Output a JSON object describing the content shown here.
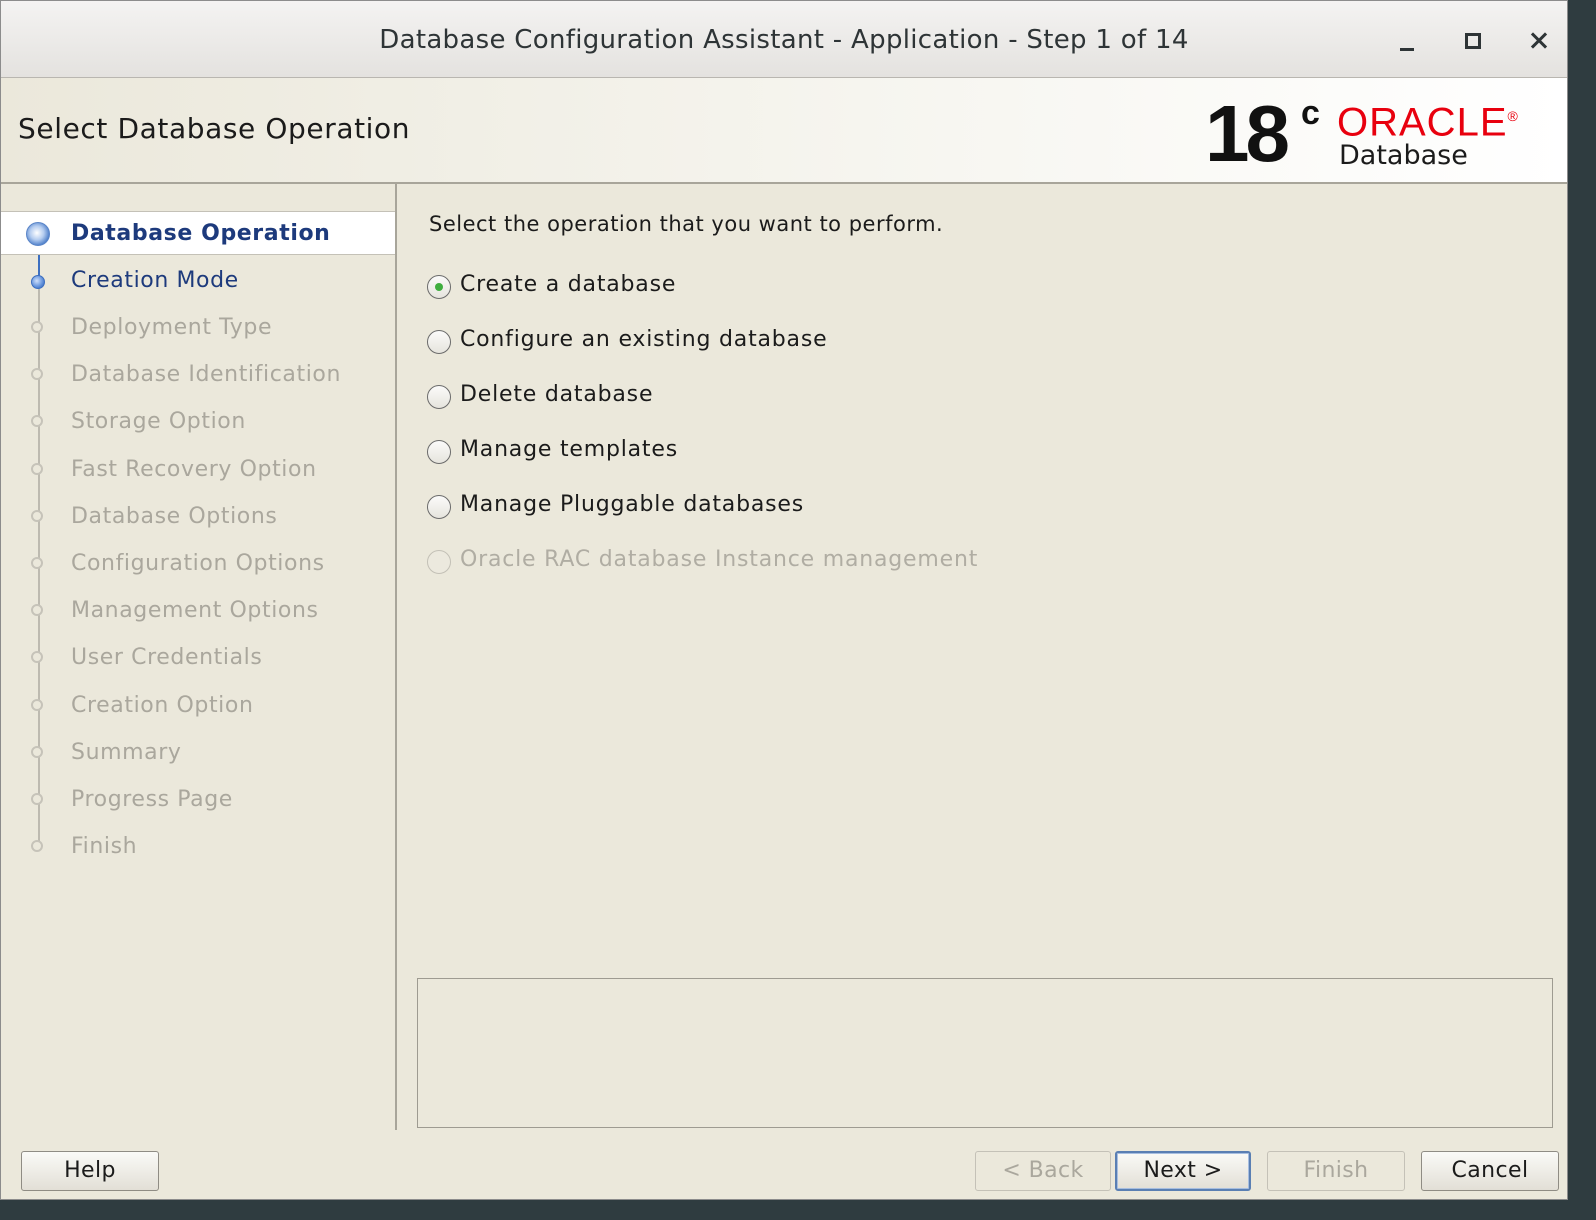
{
  "window": {
    "title": "Database Configuration Assistant - Application - Step 1 of 14"
  },
  "header": {
    "page_title": "Select Database Operation",
    "logo": {
      "version": "18",
      "version_sup": "c",
      "brand": "ORACLE",
      "brand_mark": "®",
      "product": "Database",
      "brand_color": "#e8000e"
    }
  },
  "sidebar": {
    "steps": [
      {
        "label": "Database Operation",
        "state": "current"
      },
      {
        "label": "Creation Mode",
        "state": "link"
      },
      {
        "label": "Deployment Type",
        "state": "disabled"
      },
      {
        "label": "Database Identification",
        "state": "disabled"
      },
      {
        "label": "Storage Option",
        "state": "disabled"
      },
      {
        "label": "Fast Recovery Option",
        "state": "disabled"
      },
      {
        "label": "Database Options",
        "state": "disabled"
      },
      {
        "label": "Configuration Options",
        "state": "disabled"
      },
      {
        "label": "Management Options",
        "state": "disabled"
      },
      {
        "label": "User Credentials",
        "state": "disabled"
      },
      {
        "label": "Creation Option",
        "state": "disabled"
      },
      {
        "label": "Summary",
        "state": "disabled"
      },
      {
        "label": "Progress Page",
        "state": "disabled"
      },
      {
        "label": "Finish",
        "state": "disabled"
      }
    ]
  },
  "main": {
    "instruction": "Select the operation that you want to perform.",
    "options": [
      {
        "label": "Create a database",
        "checked": true,
        "enabled": true
      },
      {
        "label": "Configure an existing database",
        "checked": false,
        "enabled": true
      },
      {
        "label": "Delete database",
        "checked": false,
        "enabled": true
      },
      {
        "label": "Manage templates",
        "checked": false,
        "enabled": true
      },
      {
        "label": "Manage Pluggable databases",
        "checked": false,
        "enabled": true
      },
      {
        "label": "Oracle RAC database Instance management",
        "checked": false,
        "enabled": false
      }
    ]
  },
  "footer": {
    "help_label": "Help",
    "back_label": "< Back",
    "next_label": "Next >",
    "finish_label": "Finish",
    "cancel_label": "Cancel"
  },
  "colors": {
    "window_bg": "#ebe8db",
    "link_blue": "#1d3a7c",
    "radio_selected": "#3fae3f"
  }
}
